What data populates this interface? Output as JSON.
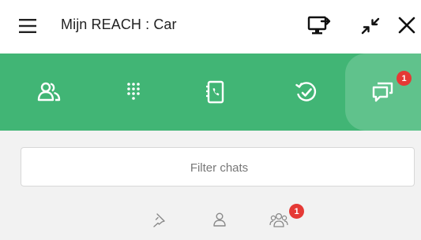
{
  "window": {
    "title": "Mijn REACH : Car",
    "menu_icon": "hamburger-icon",
    "buttons": [
      "monitor-share-icon",
      "minimize-icon",
      "close-icon"
    ]
  },
  "nav": {
    "tabs": [
      {
        "name": "contacts",
        "icon": "users-icon"
      },
      {
        "name": "dialpad",
        "icon": "dialpad-icon"
      },
      {
        "name": "phonebook",
        "icon": "address-book-icon"
      },
      {
        "name": "history",
        "icon": "history-check-icon"
      },
      {
        "name": "chats",
        "icon": "chat-icon",
        "badge": "1",
        "active": true
      }
    ],
    "background": "#41b575",
    "active_background": "#60c28c"
  },
  "search": {
    "placeholder": "Filter chats",
    "value": ""
  },
  "filters": [
    {
      "name": "pinned",
      "icon": "pin-icon"
    },
    {
      "name": "direct",
      "icon": "user-icon"
    },
    {
      "name": "groups",
      "icon": "group-icon",
      "badge": "1"
    }
  ],
  "colors": {
    "badge": "#e53935"
  }
}
